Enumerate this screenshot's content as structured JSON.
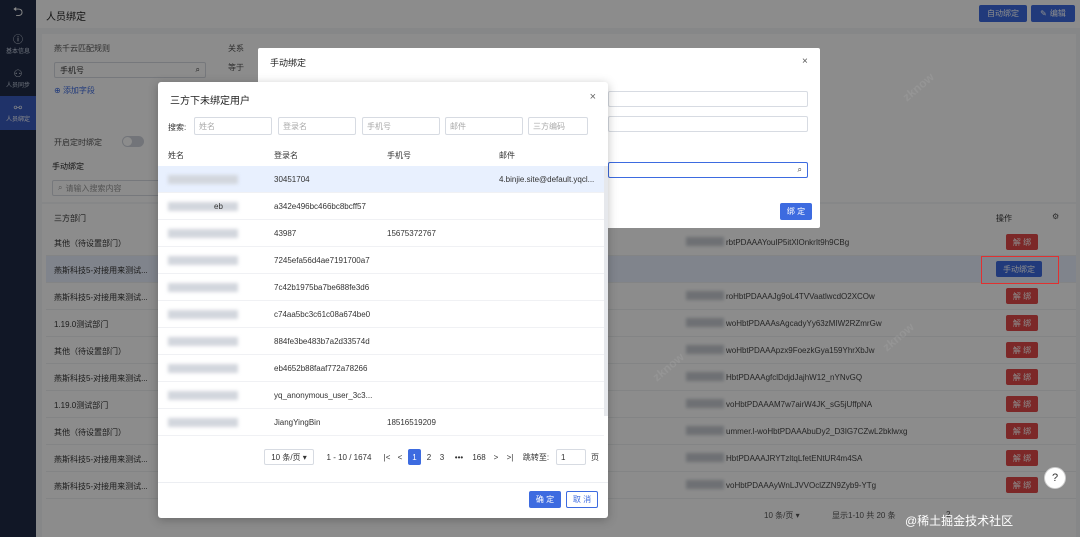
{
  "sidebar": {
    "back_icon": "back-arrow-icon",
    "items": [
      {
        "label": "基本信息",
        "icon": "info-icon"
      },
      {
        "label": "人员同步",
        "icon": "user-sync-icon"
      },
      {
        "label": "人员绑定",
        "icon": "org-tree-icon"
      }
    ]
  },
  "header": {
    "title": "人员绑定",
    "auto_bind": "自动绑定",
    "edit": "编辑"
  },
  "config": {
    "rule_label": "燕千云匹配规则",
    "relation_label": "关系",
    "equals_label": "等于",
    "rule_value": "手机号",
    "add_field": "添加字段",
    "timer_label": "开启定时绑定",
    "manual_section": "手动绑定",
    "search_placeholder": "请输入搜索内容",
    "dept_col": "三方部门",
    "ops_col": "操作"
  },
  "back_rows": [
    {
      "dept": "其他（待设置部门）",
      "openid": "rbtPDAAAYouIP5itXlOnkrIt9h9CBg",
      "action": "解 绑"
    },
    {
      "dept": "燕斯科技5-对接用来测试...",
      "openid": "",
      "action": "手动绑定"
    },
    {
      "dept": "燕斯科技5-对接用来测试...",
      "openid": "roHbtPDAAAJg9oL4TVVaatlwcdO2XCOw",
      "action": "解 绑"
    },
    {
      "dept": "1.19.0测试部门",
      "openid": "woHbtPDAAAsAgcadyYy63zMIW2RZmrGw",
      "action": "解 绑"
    },
    {
      "dept": "其他（待设置部门）",
      "openid": "woHbtPDAAApzx9FoezkGya159YhrXbJw",
      "action": "解 绑"
    },
    {
      "dept": "燕斯科技5-对接用来测试...",
      "openid": "HbtPDAAAgfclDdjdJajhW12_nYNvGQ",
      "action": "解 绑"
    },
    {
      "dept": "1.19.0测试部门",
      "openid": "voHbtPDAAAM7w7airW4JK_sG5jUffpNA",
      "action": "解 绑"
    },
    {
      "dept": "其他（待设置部门）",
      "openid": "ummer.l-woHbtPDAAAbuDy2_D3IG7CZwL2bklwxg",
      "action": "解 绑"
    },
    {
      "dept": "燕斯科技5-对接用来测试...",
      "openid": "HbtPDAAAJRYTzltqLfetENtUR4m4SA",
      "action": "解 绑"
    },
    {
      "dept": "燕斯科技5-对接用来测试...",
      "openid": "voHbtPDAAAyWnLJVVOclZZN9Zyb9-YTg",
      "action": "解 绑"
    }
  ],
  "back_footer": {
    "page_size": "10 条/页",
    "summary": "显示1-10 共 20 条",
    "page2": "2"
  },
  "manual_dialog": {
    "title": "手动绑定",
    "bind_button": "绑 定"
  },
  "dialog": {
    "title": "三方下未绑定用户",
    "search_label": "搜索:",
    "filters": [
      "姓名",
      "登录名",
      "手机号",
      "邮件",
      "三方编码"
    ],
    "columns": [
      "姓名",
      "登录名",
      "手机号",
      "邮件"
    ],
    "rows": [
      {
        "name_tail": "",
        "login": "30451704",
        "phone": "",
        "email": "4.binjie.site@default.yqcl..."
      },
      {
        "name_tail": "eb",
        "login": "a342e496bc466bc8bcff57",
        "phone": "",
        "email": ""
      },
      {
        "name_tail": "",
        "login": "43987",
        "phone": "15675372767",
        "email": ""
      },
      {
        "name_tail": "",
        "login": "7245efa56d4ae7191700a7",
        "phone": "",
        "email": ""
      },
      {
        "name_tail": "",
        "login": "7c42b1975ba7be688fe3d6",
        "phone": "",
        "email": ""
      },
      {
        "name_tail": "",
        "login": "c74aa5bc3c61c08a674be0",
        "phone": "",
        "email": ""
      },
      {
        "name_tail": "",
        "login": "884fe3be483b7a2d33574d",
        "phone": "",
        "email": ""
      },
      {
        "name_tail": "",
        "login": "eb4652b88faaf772a78266",
        "phone": "",
        "email": ""
      },
      {
        "name_tail": "",
        "login": "yq_anonymous_user_3c3...",
        "phone": "",
        "email": ""
      },
      {
        "name_tail": "",
        "login": "JiangYingBin",
        "phone": "18516519209",
        "email": ""
      }
    ],
    "pager": {
      "page_size": "10 条/页",
      "range": "1 - 10 / 1674",
      "first": "|<",
      "prev": "<",
      "pages": [
        "1",
        "2",
        "3"
      ],
      "ellipsis": "•••",
      "last_page": "168",
      "next": ">",
      "last": ">|",
      "jump_label": "跳转至:",
      "jump_value": "1",
      "page_unit": "页"
    },
    "ok": "确 定",
    "cancel": "取 消"
  },
  "credit": "@稀土掘金技术社区",
  "help_icon": "?",
  "highlight_color": "#e03131",
  "accent_color": "#3d6be0"
}
